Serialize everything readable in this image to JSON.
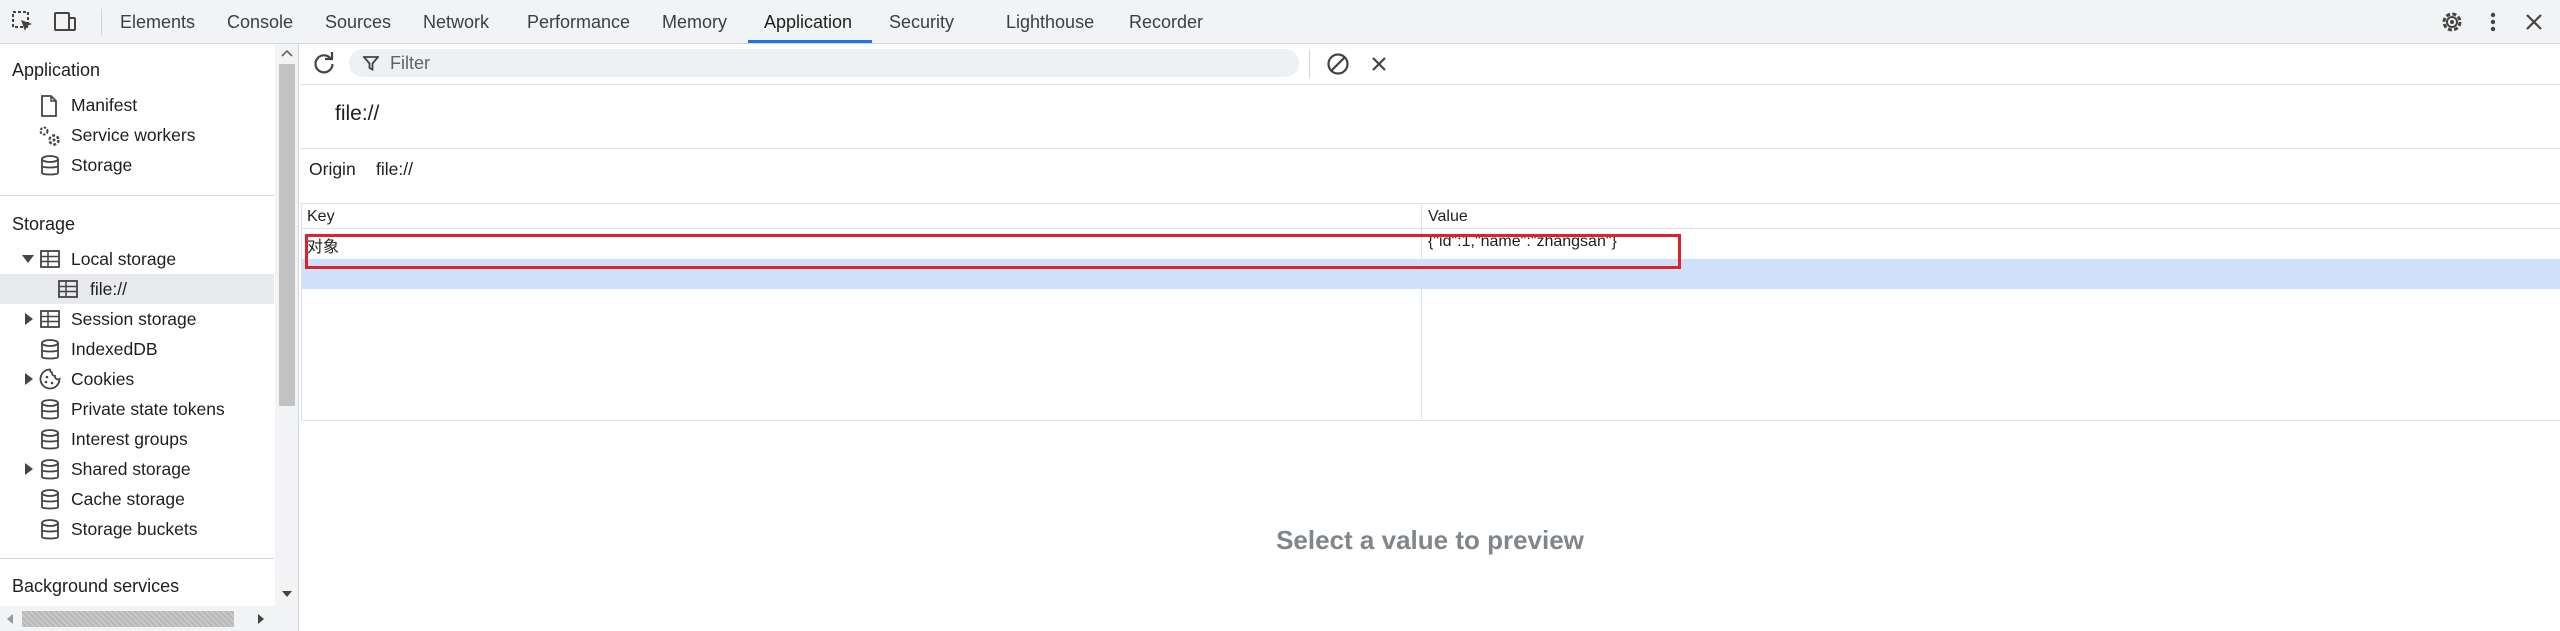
{
  "toolbar": {
    "inspect_icon": "inspect-element-icon",
    "device_icon": "device-toolbar-icon",
    "tabs": [
      "Elements",
      "Console",
      "Sources",
      "Network",
      "Performance",
      "Memory",
      "Application",
      "Security",
      "Lighthouse",
      "Recorder"
    ],
    "active_tab": "Application",
    "settings_icon": "gear-icon",
    "more_icon": "more-vertical-icon",
    "close_icon": "close-icon"
  },
  "sidebar": {
    "application_header": "Application",
    "application_items": [
      "Manifest",
      "Service workers",
      "Storage"
    ],
    "storage_header": "Storage",
    "storage_items": [
      "Local storage",
      "file://",
      "Session storage",
      "IndexedDB",
      "Cookies",
      "Private state tokens",
      "Interest groups",
      "Shared storage",
      "Cache storage",
      "Storage buckets"
    ],
    "background_header": "Background services"
  },
  "main": {
    "filter_placeholder": "Filter",
    "origin_title": "file://",
    "origin_label": "Origin",
    "origin_value": "file://",
    "columns": [
      "Key",
      "Value"
    ],
    "rows": [
      {
        "key": "对象",
        "value": "{\"id\":1,\"name\":\"zhangsan\"}"
      }
    ],
    "preview_text": "Select a value to preview"
  },
  "colors": {
    "accent": "#1a73e8",
    "highlight_box": "#e0202a",
    "selected_row": "#cfe0fa"
  }
}
